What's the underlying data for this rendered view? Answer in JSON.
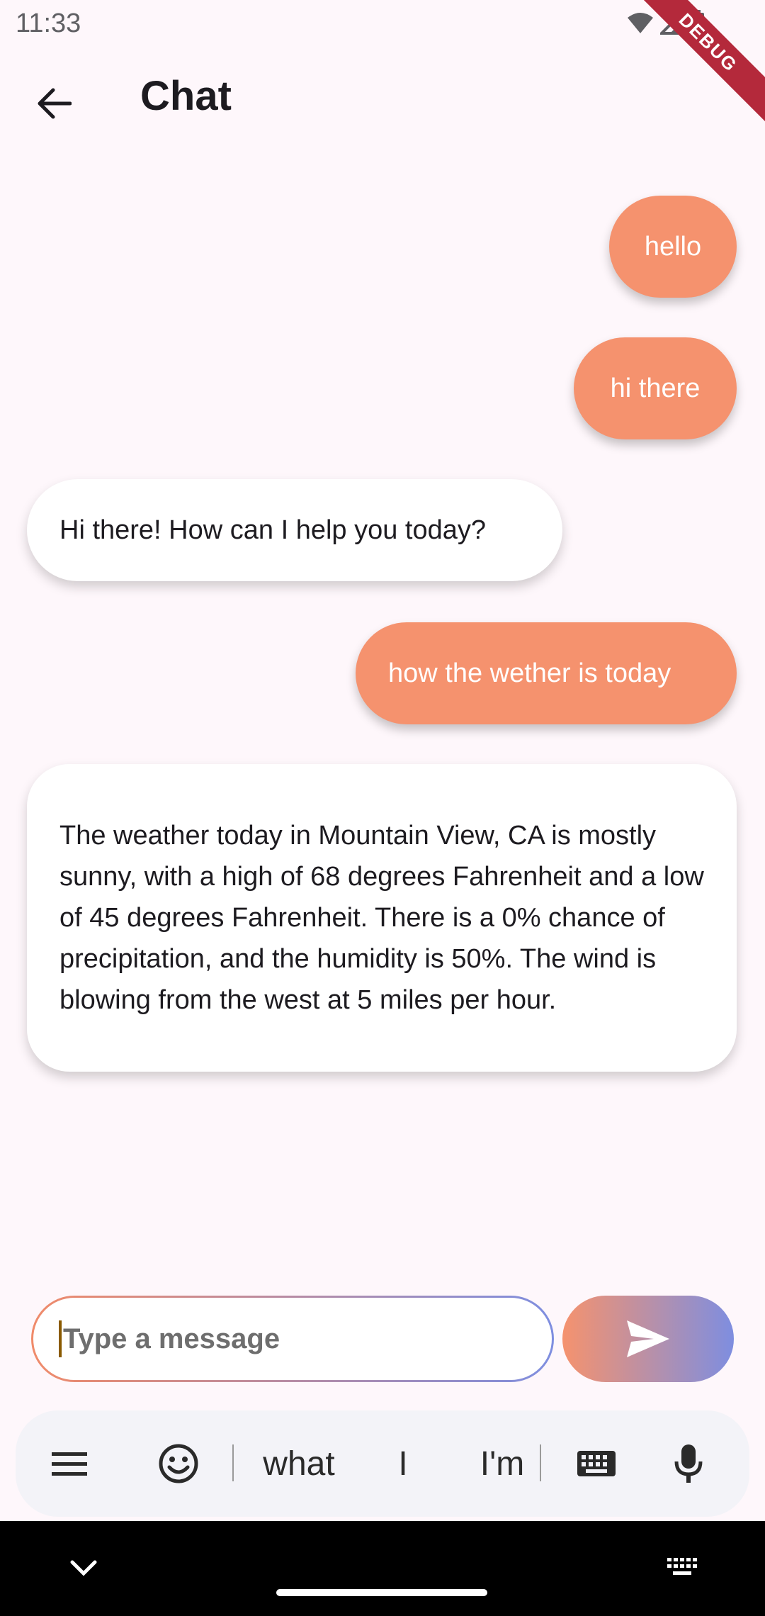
{
  "status_bar": {
    "time": "11:33",
    "debug_label": "DEBUG"
  },
  "app_bar": {
    "title": "Chat"
  },
  "messages": [
    {
      "role": "user",
      "text": "hello"
    },
    {
      "role": "user",
      "text": "hi there"
    },
    {
      "role": "bot",
      "text": "Hi there! How can I help you today?"
    },
    {
      "role": "user",
      "text": "how the wether is today"
    },
    {
      "role": "bot",
      "text": "The weather today in Mountain View, CA is mostly sunny, with a high of 68 degrees Fahrenheit and a low of 45 degrees Fahrenheit. There is a 0% chance of precipitation, and the humidity is 50%. The wind is blowing from the west at 5 miles per hour."
    }
  ],
  "composer": {
    "placeholder": "Type a message",
    "value": ""
  },
  "keyboard": {
    "suggestions": [
      "what",
      "I",
      "I'm"
    ]
  },
  "colors": {
    "user_bubble": "#f5926e",
    "bot_bubble": "#ffffff",
    "gradient_start": "#f5926e",
    "gradient_end": "#7e8ee0"
  }
}
